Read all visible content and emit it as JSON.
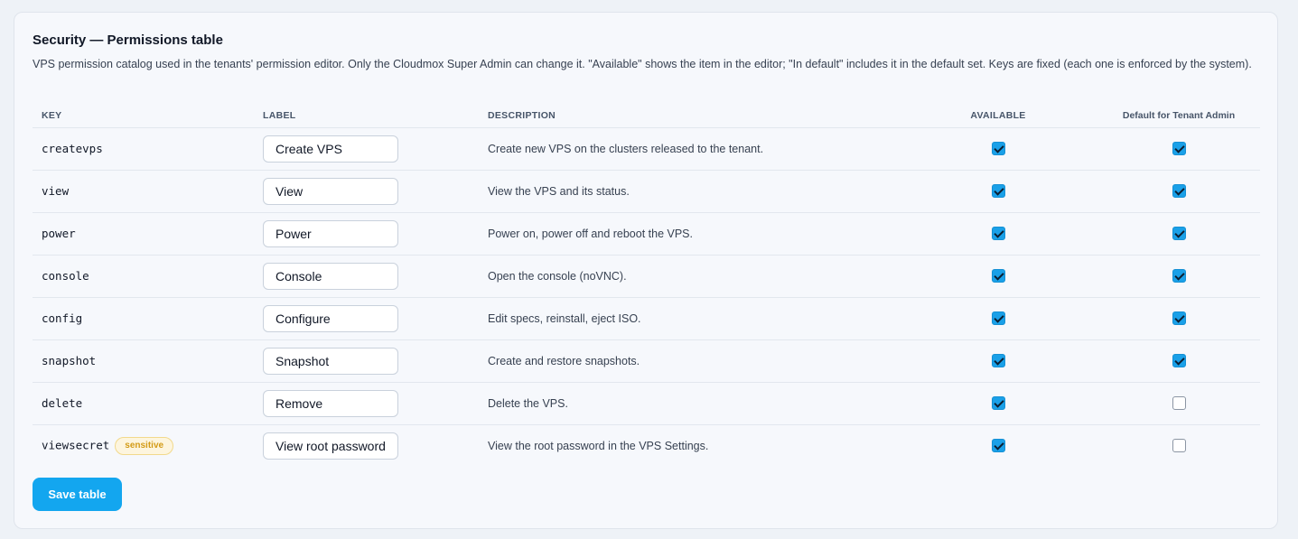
{
  "card": {
    "title": "Security — Permissions table",
    "description": "VPS permission catalog used in the tenants' permission editor. Only the Cloudmox Super Admin can change it. \"Available\" shows the item in the editor; \"In default\" includes it in the default set. Keys are fixed (each one is enforced by the system)."
  },
  "table": {
    "headers": {
      "key": "KEY",
      "label": "LABEL",
      "description": "DESCRIPTION",
      "available": "AVAILABLE",
      "default": "Default for Tenant Admin"
    },
    "rows": [
      {
        "key": "createvps",
        "label": "Create VPS",
        "description": "Create new VPS on the clusters released to the tenant.",
        "available": true,
        "default": true
      },
      {
        "key": "view",
        "label": "View",
        "description": "View the VPS and its status.",
        "available": true,
        "default": true
      },
      {
        "key": "power",
        "label": "Power",
        "description": "Power on, power off and reboot the VPS.",
        "available": true,
        "default": true
      },
      {
        "key": "console",
        "label": "Console",
        "description": "Open the console (noVNC).",
        "available": true,
        "default": true
      },
      {
        "key": "config",
        "label": "Configure",
        "description": "Edit specs, reinstall, eject ISO.",
        "available": true,
        "default": true
      },
      {
        "key": "snapshot",
        "label": "Snapshot",
        "description": "Create and restore snapshots.",
        "available": true,
        "default": true
      },
      {
        "key": "delete",
        "label": "Remove",
        "description": "Delete the VPS.",
        "available": true,
        "default": false
      },
      {
        "key": "viewsecret",
        "badge": "sensitive",
        "label": "View root password",
        "description": "View the root password in the VPS Settings.",
        "available": true,
        "default": false
      }
    ]
  },
  "actions": {
    "save_label": "Save table"
  },
  "colors": {
    "accent": "#13a6ef",
    "checkbox_checked": "#1aa0e8",
    "badge_text": "#d39b17",
    "badge_bg": "#fdf5de"
  }
}
